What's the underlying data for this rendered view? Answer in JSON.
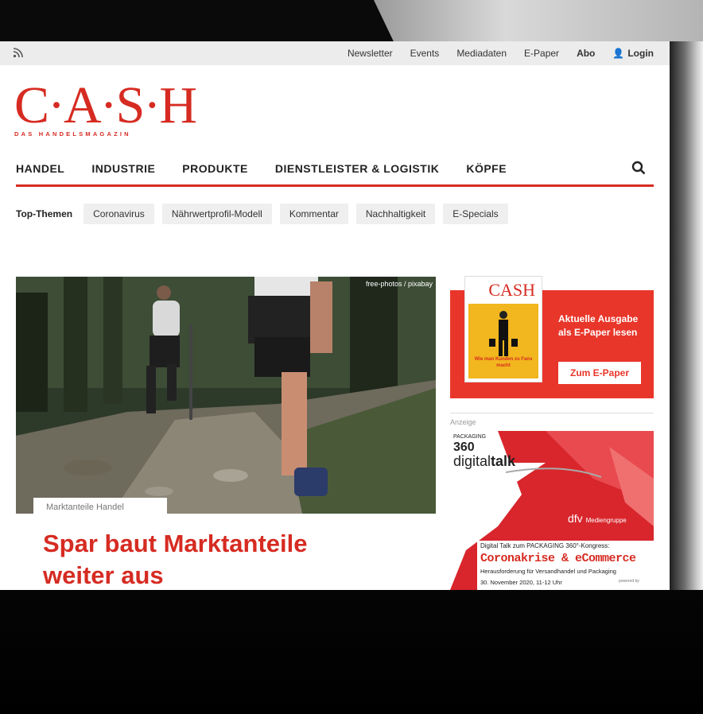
{
  "topbar": {
    "rss_icon": "rss-icon",
    "links": [
      "Newsletter",
      "Events",
      "Mediadaten",
      "E-Paper",
      "Abo"
    ],
    "login": "Login"
  },
  "logo": {
    "text": "C·A·S·H",
    "subtitle": "DAS HANDELSMAGAZIN"
  },
  "nav": {
    "items": [
      "HANDEL",
      "INDUSTRIE",
      "PRODUKTE",
      "DIENSTLEISTER & LOGISTIK",
      "KÖPFE"
    ]
  },
  "top_themen": {
    "label": "Top-Themen",
    "items": [
      "Coronavirus",
      "Nährwertprofil-Modell",
      "Kommentar",
      "Nachhaltigkeit",
      "E-Specials"
    ]
  },
  "article": {
    "image_credit": "free-photos / pixabay",
    "kicker": "Marktanteile Handel",
    "headline": "Spar baut Marktanteile weiter  aus"
  },
  "epaper": {
    "cover_logo": "CASH",
    "cover_caption": "Wie man Kunden zu Fans macht",
    "text": "Aktuelle Ausgabe als E-Paper lesen",
    "button": "Zum E-Paper"
  },
  "ad": {
    "label": "Anzeige",
    "packaging_small": "PACKAGING",
    "packaging_num": "360",
    "digital": "digital",
    "talk": "talk",
    "dfv": "dfv",
    "mediengruppe": "Mediengruppe",
    "line1": "Digital Talk zum PACKAGING 360°-Kongress:",
    "line2": "Coronakrise & eCommerce",
    "line3": "Herausforderung für Versandhandel und Packaging",
    "line4": "30. November 2020, 11-12 Uhr",
    "powered": "powered by"
  },
  "colors": {
    "brand_red": "#d62b22",
    "epaper_red": "#e9362a"
  }
}
